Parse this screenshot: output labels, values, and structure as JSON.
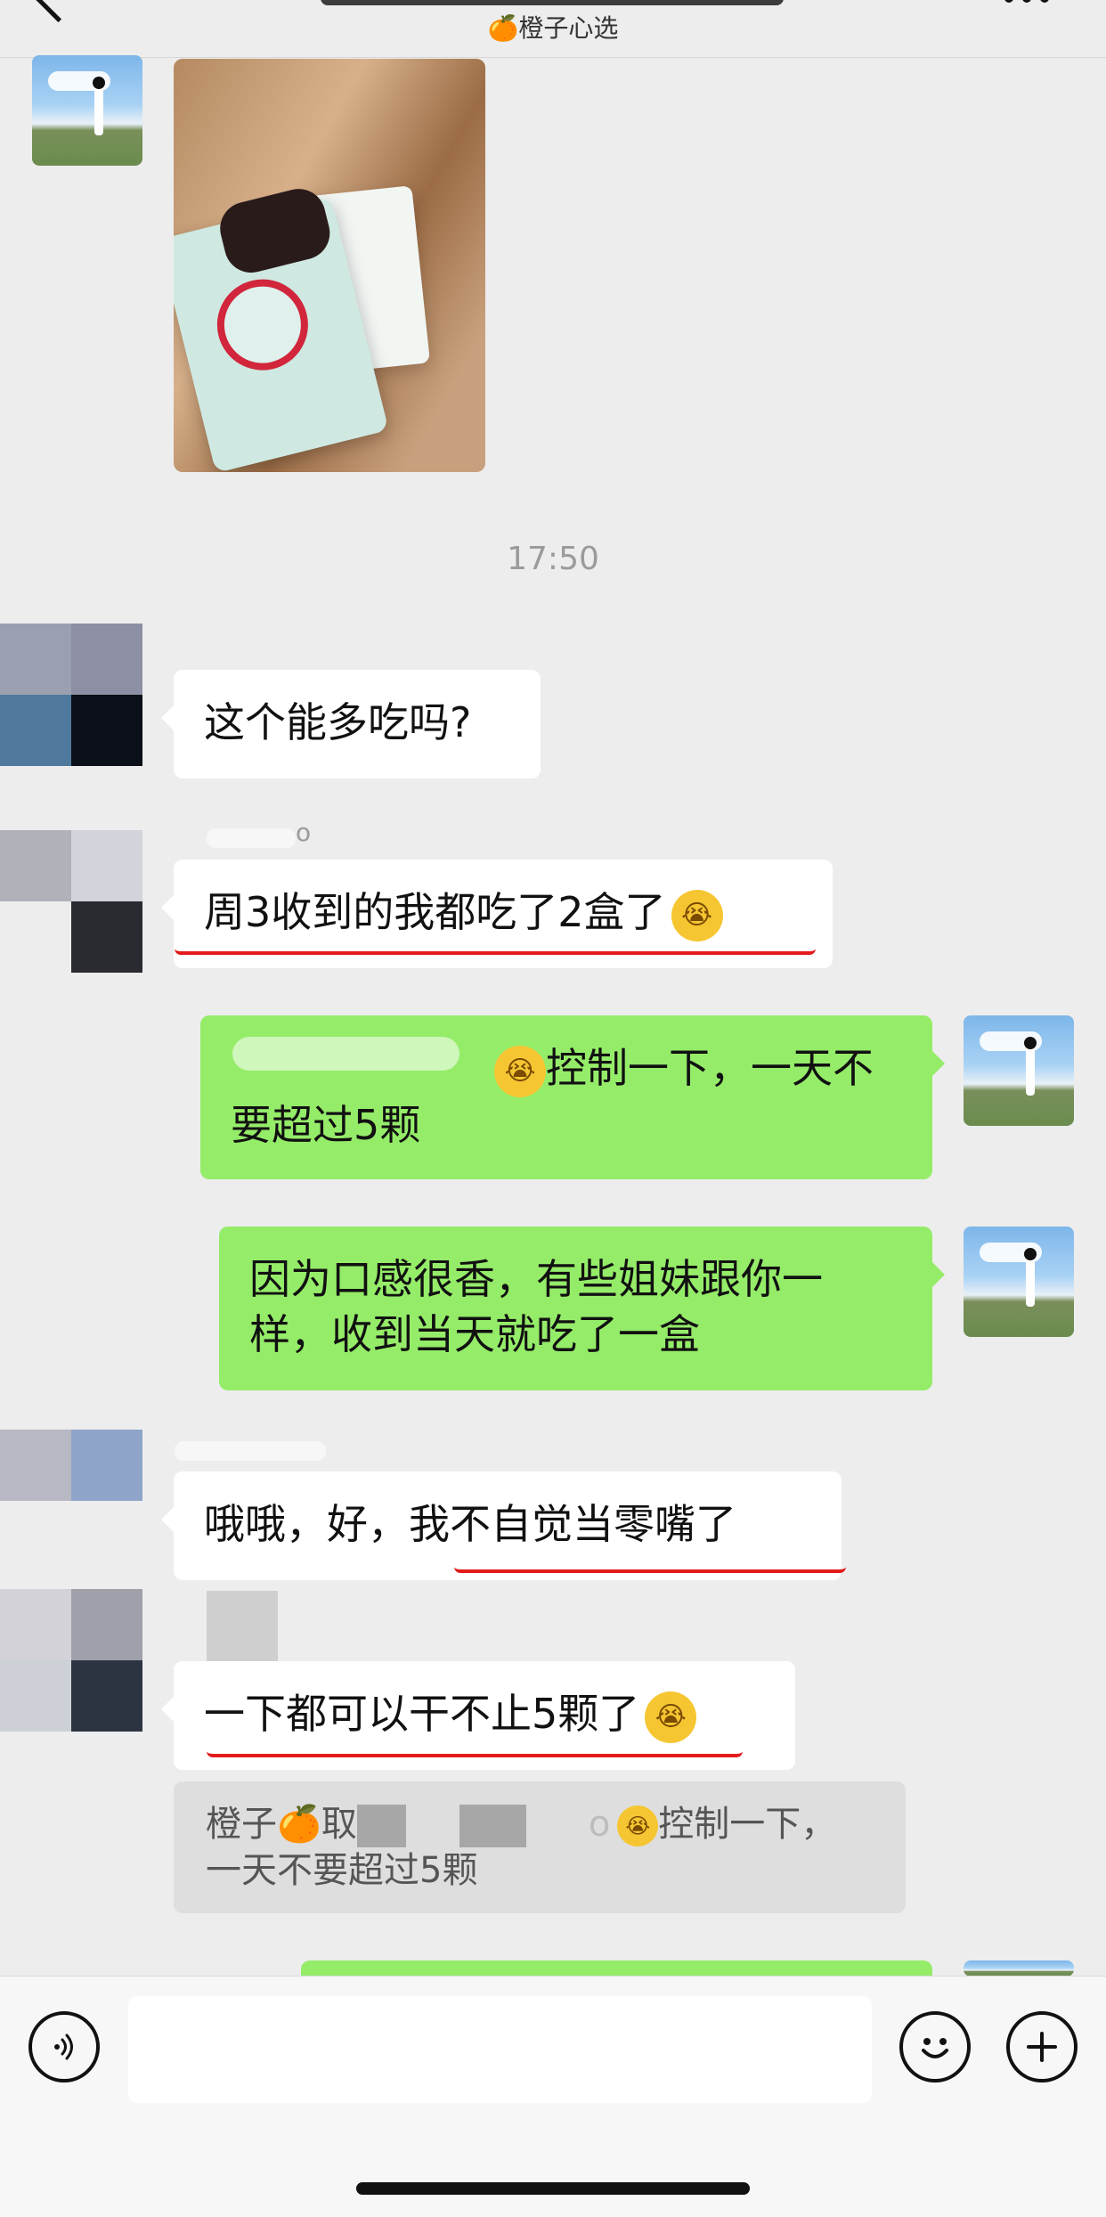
{
  "header": {
    "subtitle": "🍊橙子心选"
  },
  "chat": {
    "time": "17:50",
    "messages": [
      {
        "id": "m1",
        "text": "这个能多吃吗?"
      },
      {
        "id": "m2",
        "sender_fragment": "o",
        "text_before_emoji": "周3收到的我都吃了2盒了",
        "emoji": "😭"
      },
      {
        "id": "m3",
        "line1_text_after_emoji": "控制一下，一天不",
        "line2": "要超过5颗",
        "emoji": "😭"
      },
      {
        "id": "m4",
        "line1": "因为口感很香，有些姐妹跟你一",
        "line2": "样，收到当天就吃了一盒"
      },
      {
        "id": "m5",
        "text": "哦哦，好，我不自觉当零嘴了"
      },
      {
        "id": "m6",
        "text_before_emoji": "一下都可以干不止5颗了",
        "emoji": "😭"
      }
    ],
    "quote": {
      "prefix": "橙子",
      "orange": "🍊",
      "mid": "取",
      "small": "o",
      "emoji": "😭",
      "line1_tail": "控制一下，",
      "line2": "一天不要超过5颗"
    }
  },
  "icons": {
    "back": "chevron-left-icon",
    "more": "more-dots-icon",
    "voice": "voice-icon",
    "emoji": "emoji-icon",
    "plus": "plus-icon"
  },
  "colors": {
    "background": "#ededed",
    "incoming_bubble": "#ffffff",
    "outgoing_bubble": "#95ec69",
    "annotation_red": "#e31b1b"
  }
}
